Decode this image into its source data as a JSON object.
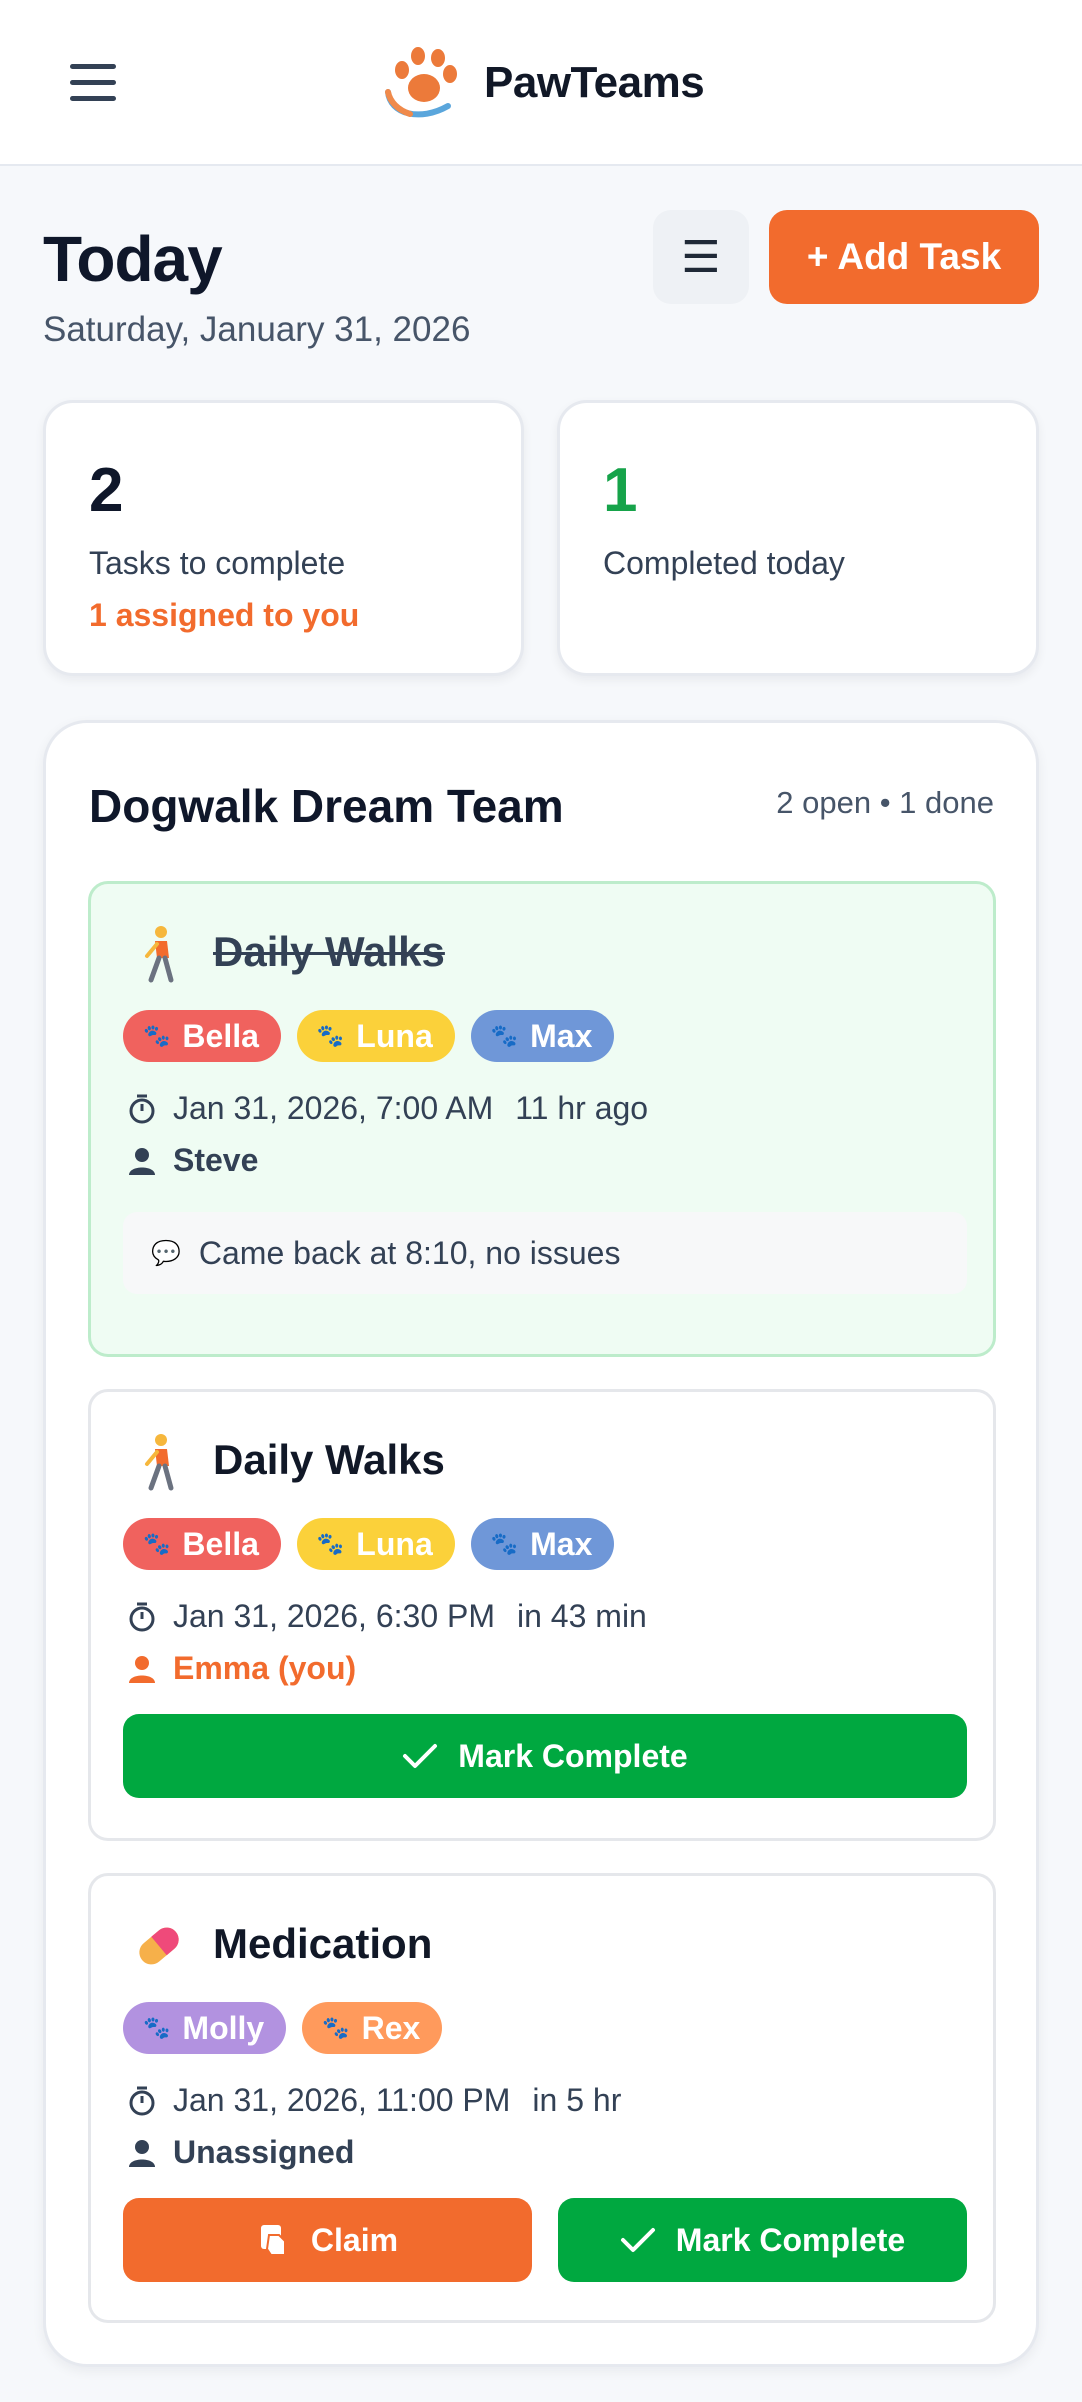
{
  "app": {
    "name": "PawTeams"
  },
  "header": {
    "title": "Today",
    "date": "Saturday, January 31, 2026",
    "list_view_glyph": "☰",
    "add_task_label": "+ Add Task"
  },
  "stats": {
    "to_complete": {
      "value": "2",
      "label": "Tasks to complete",
      "sub": "1 assigned to you"
    },
    "completed": {
      "value": "1",
      "label": "Completed today"
    }
  },
  "team": {
    "name": "Dogwalk Dream Team",
    "summary": "2 open • 1 done",
    "tasks": [
      {
        "title": "Daily Walks",
        "status": "done",
        "icon": "person-walking-icon",
        "pets": [
          {
            "name": "Bella",
            "color": "#f0625e"
          },
          {
            "name": "Luna",
            "color": "#fbd13a"
          },
          {
            "name": "Max",
            "color": "#6f97d8"
          }
        ],
        "time": "Jan 31, 2026, 7:00 AM",
        "relative": "11 hr ago",
        "assignee": "Steve",
        "note": "Came back at 8:10, no issues"
      },
      {
        "title": "Daily Walks",
        "status": "open",
        "icon": "person-walking-icon",
        "pets": [
          {
            "name": "Bella",
            "color": "#f0625e"
          },
          {
            "name": "Luna",
            "color": "#fbd13a"
          },
          {
            "name": "Max",
            "color": "#6f97d8"
          }
        ],
        "time": "Jan 31, 2026, 6:30 PM",
        "relative": "in 43 min",
        "assignee": "Emma (you)",
        "complete_label": "Mark Complete"
      },
      {
        "title": "Medication",
        "status": "open",
        "icon": "pill-icon",
        "pets": [
          {
            "name": "Molly",
            "color": "#b292e0"
          },
          {
            "name": "Rex",
            "color": "#ff9a5c"
          }
        ],
        "time": "Jan 31, 2026, 11:00 PM",
        "relative": "in 5 hr",
        "assignee": "Unassigned",
        "claim_label": "Claim",
        "complete_label": "Mark Complete"
      }
    ]
  },
  "colors": {
    "accent": "#f26b2d",
    "success": "#00a840",
    "done_bg": "#effcf3"
  }
}
